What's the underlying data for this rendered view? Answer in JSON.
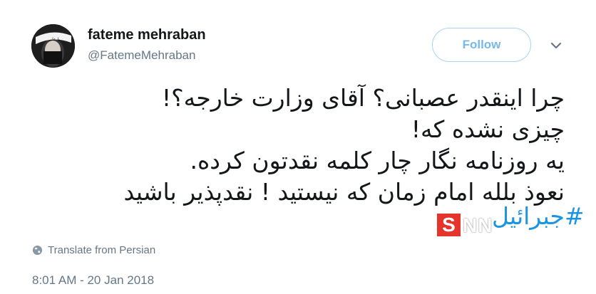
{
  "author": {
    "name": "fateme mehraban",
    "handle": "@FatemeMehraban",
    "avatar_headband_text": "یا علی"
  },
  "follow_label": "Follow",
  "tweet": {
    "lines": [
      "چرا اینقدر عصبانی؟ آقای وزارت خارجه؟!",
      "چیزی نشده که!",
      "یه روزنامه نگار چار کلمه نقدتون کرده.",
      "نعوذ بلله امام زمان که نیستید ! نقدپذیر باشید"
    ],
    "hashtag": "#جبرائیل"
  },
  "watermark": {
    "letter": "S",
    "text": "NN"
  },
  "translate_label": "Translate from Persian",
  "timestamp": "8:01 AM - 20 Jan 2018",
  "colors": {
    "link": "#1b95e0",
    "follow_text": "#78b8e8",
    "follow_border": "#a6d3f2",
    "secondary_text": "#657786",
    "watermark_red": "#e2231a"
  },
  "icons": [
    "chevron-down-icon",
    "globe-icon"
  ]
}
